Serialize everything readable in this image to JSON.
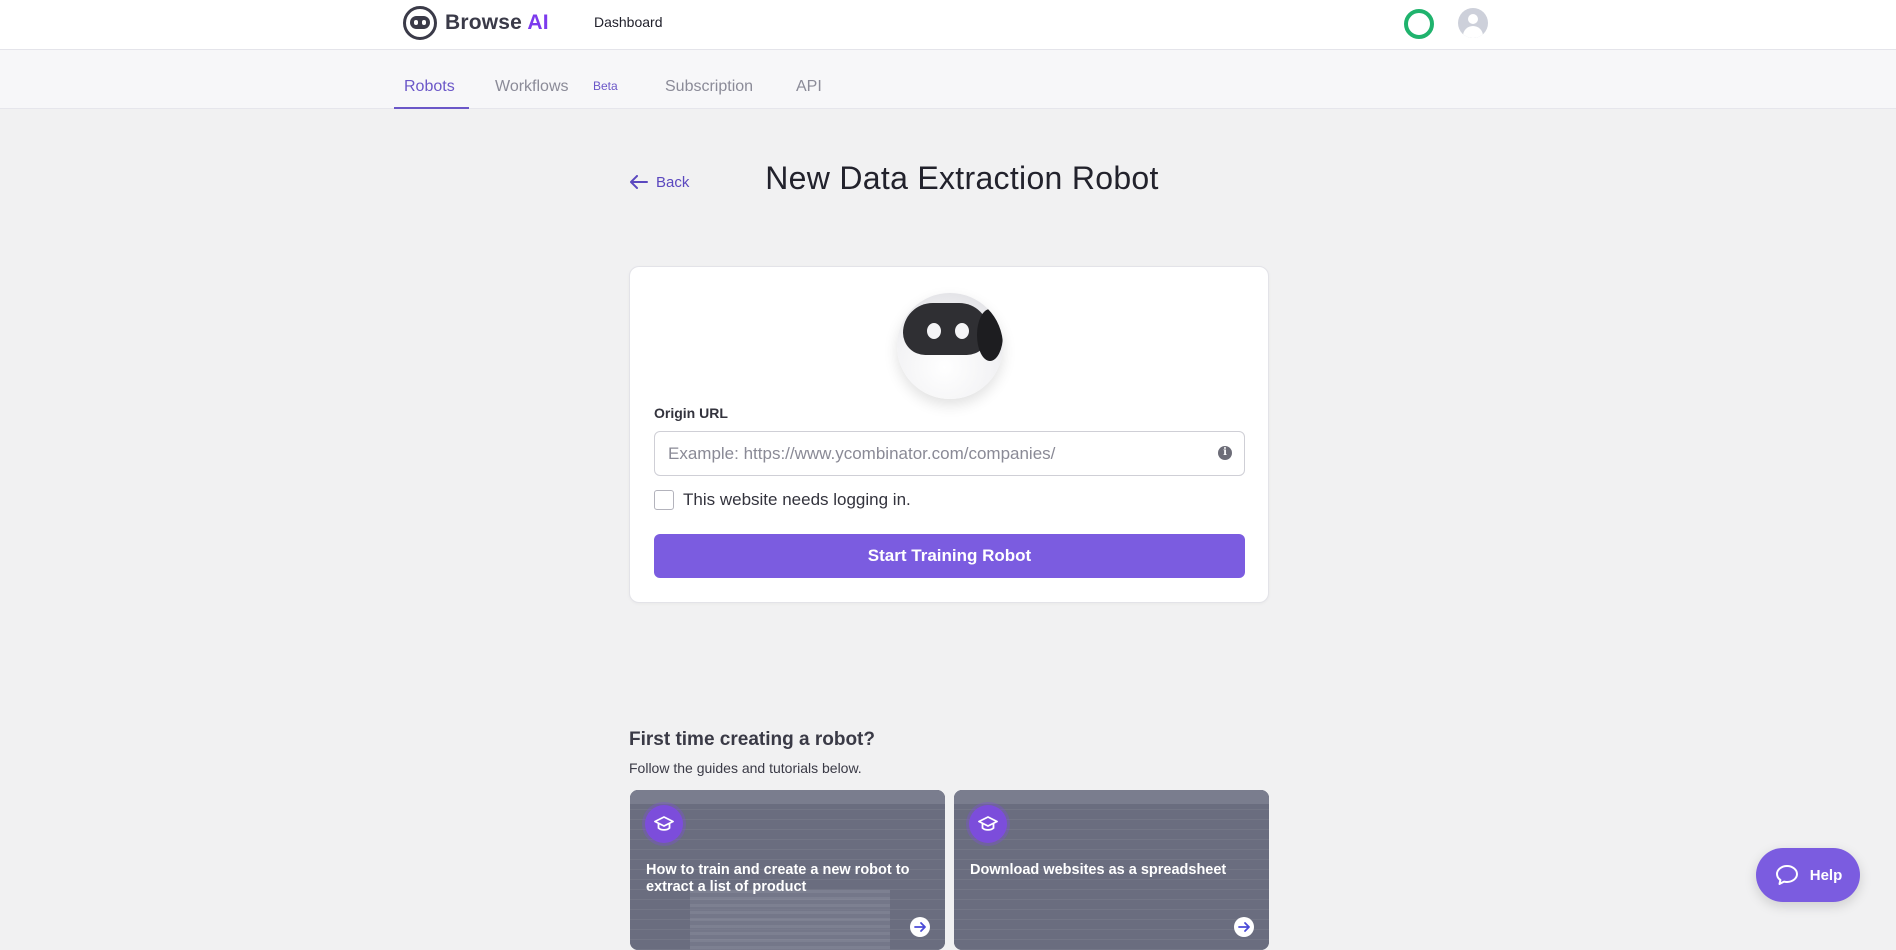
{
  "header": {
    "brand_primary": "Browse",
    "brand_accent": "AI",
    "dashboard_link": "Dashboard",
    "accent_color": "#7c3aed",
    "status_color": "#1fb36d"
  },
  "tabs": [
    {
      "label": "Robots",
      "active": true
    },
    {
      "label": "Workflows",
      "badge": "Beta"
    },
    {
      "label": "Subscription"
    },
    {
      "label": "API"
    }
  ],
  "page": {
    "back_label": "Back",
    "title": "New Data Extraction Robot"
  },
  "form": {
    "url_label": "Origin URL",
    "url_placeholder": "Example: https://www.ycombinator.com/companies/",
    "url_value": "",
    "login_checkbox_label": "This website needs logging in.",
    "login_checked": false,
    "submit_label": "Start Training Robot",
    "button_color": "#7b5ce0"
  },
  "guides": {
    "title": "First time creating a robot?",
    "subtitle": "Follow the guides and tutorials below.",
    "items": [
      {
        "text": "How to train and create a new robot to extract a list of product",
        "icon": "graduation-cap-icon"
      },
      {
        "text": "Download websites as a spreadsheet",
        "icon": "graduation-cap-icon"
      }
    ]
  },
  "help": {
    "label": "Help",
    "icon": "chat-bubble-icon"
  }
}
